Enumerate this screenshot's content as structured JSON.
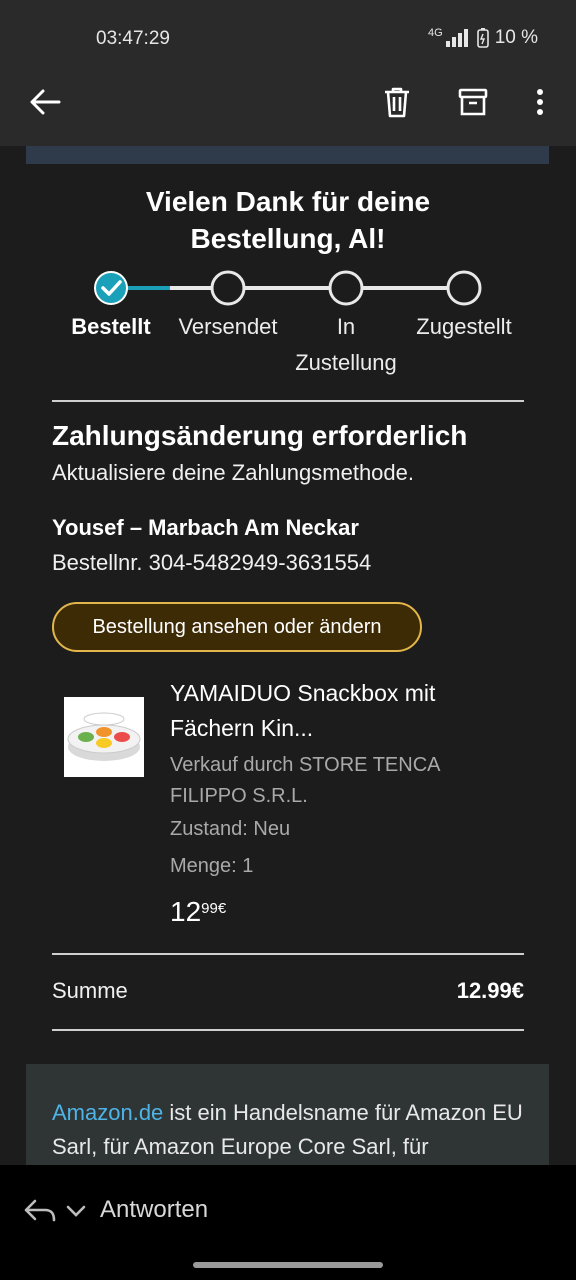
{
  "status_bar": {
    "time": "03:47:29",
    "network": "4G",
    "battery": "10 %"
  },
  "app_bar": {
    "back_icon": "arrow-left-icon",
    "delete_icon": "trash-icon",
    "archive_icon": "archive-icon",
    "more_icon": "more-vertical-icon"
  },
  "email": {
    "thanks_line1": "Vielen Dank für deine",
    "thanks_line2": "Bestellung, Al!",
    "progress": {
      "steps": [
        {
          "label": "Bestellt",
          "done": true
        },
        {
          "label": "Versendet",
          "done": false
        },
        {
          "label_line1": "In",
          "label_line2": "Zustellung",
          "done": false
        },
        {
          "label": "Zugestellt",
          "done": false
        }
      ],
      "accent": "#1aa0b8"
    },
    "payment_title": "Zahlungsänderung erforderlich",
    "payment_subtitle": "Aktualisiere deine Zahlungsmethode.",
    "address": "Yousef – Marbach Am Neckar",
    "order_number": "Bestellnr. 304-5482949-3631554",
    "order_button": "Bestellung ansehen oder ändern",
    "product": {
      "title": "YAMAIDUO Snackbox mit Fächern Kin...",
      "seller": "Verkauf durch STORE TENCA FILIPPO S.R.L.",
      "condition": "Zustand: Neu",
      "quantity": "Menge: 1",
      "price_whole": "12",
      "price_fraction": "99€"
    },
    "sum_label": "Summe",
    "sum_value": "12.99€",
    "footer_link": "Amazon.de",
    "footer_text": " ist ein Handelsname für Amazon EU Sarl, für Amazon Europe Core Sarl, für"
  },
  "bottom_bar": {
    "reply_label": "Antworten",
    "reply_icon": "reply-icon",
    "chevron_icon": "chevron-down-icon"
  },
  "colors": {
    "background": "#1c1c1c",
    "bar": "#2a2a2a",
    "accent_teal": "#1aa0b8",
    "button_border": "#e2b64a",
    "button_fill": "#3d2b06",
    "link": "#4fb3e6"
  }
}
